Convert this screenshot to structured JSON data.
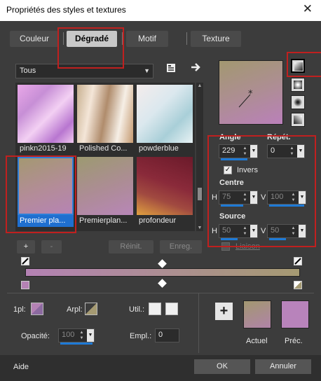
{
  "window": {
    "title": "Propriétés des styles et textures",
    "close_glyph": "✕"
  },
  "tabs": [
    {
      "label": "Couleur"
    },
    {
      "label": "Dégradé"
    },
    {
      "label": "Motif"
    },
    {
      "label": "Texture"
    }
  ],
  "category": {
    "value": "Tous"
  },
  "gradients": [
    {
      "label": "pinkn2015-19"
    },
    {
      "label": "Polished Co..."
    },
    {
      "label": "powderblue"
    },
    {
      "label": "Premier pla..."
    },
    {
      "label": "Premierplan..."
    },
    {
      "label": "profondeur"
    }
  ],
  "list_buttons": {
    "add": "+",
    "remove": "-",
    "reset": "Réinit.",
    "save": "Enreg."
  },
  "params": {
    "angle_label": "Angle",
    "angle_value": "229",
    "repeat_label": "Répét.",
    "repeat_value": "0",
    "invert_label": "Invers",
    "center_label": "Centre",
    "center_h": "75",
    "center_v": "100",
    "source_label": "Source",
    "source_h": "50",
    "source_v": "50",
    "h_label": "H",
    "v_label": "V",
    "link_label": "Liaison"
  },
  "bottom_controls": {
    "fg_label": "1pl:",
    "arpl_label": "Arpl:",
    "util_label": "Util.:",
    "opacity_label": "Opacité:",
    "opacity_value": "100",
    "empl_label": "Empl.:",
    "empl_value": "0",
    "add_glyph": "+",
    "current_label": "Actuel",
    "previous_label": "Préc."
  },
  "footer": {
    "help": "Aide",
    "ok": "OK",
    "cancel": "Annuler"
  },
  "colors": {
    "accent": "#1f6fd0",
    "highlight_box": "#c0201f",
    "gradient_start": "#b482b4",
    "gradient_end": "#a59a72"
  },
  "icons": {
    "palette_menu": "palette-menu-icon",
    "arrow": "arrow-right-icon"
  }
}
